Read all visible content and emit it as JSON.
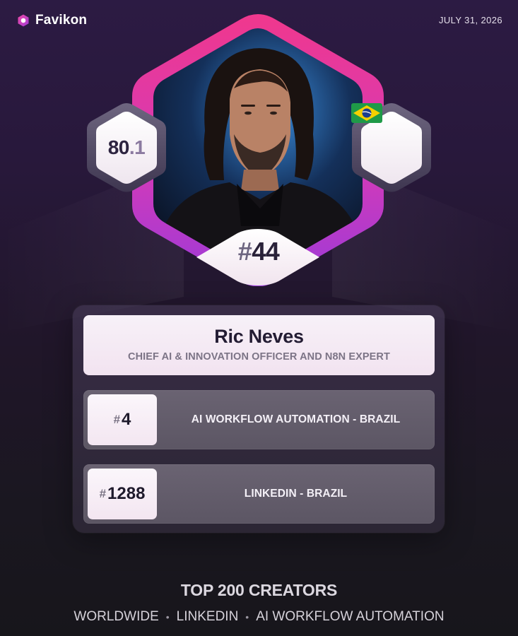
{
  "brand": {
    "name": "Favikon",
    "logo_icon": "favikon-logo-icon"
  },
  "header": {
    "date": "JULY 31, 2026"
  },
  "profile": {
    "photo_alt": "Ric Neves portrait",
    "score_whole": "80",
    "score_fraction": ".1",
    "country_flag": "brazil-flag-icon",
    "overall_rank_hash": "#",
    "overall_rank": "44",
    "name": "Ric Neves",
    "title": "CHIEF AI & INNOVATION OFFICER AND N8N EXPERT"
  },
  "rankings": [
    {
      "hash": "#",
      "rank": "4",
      "label": "AI WORKFLOW AUTOMATION - BRAZIL"
    },
    {
      "hash": "#",
      "rank": "1288",
      "label": "LINKEDIN - BRAZIL"
    }
  ],
  "footer": {
    "title": "TOP 200 CREATORS",
    "tags": [
      "WORLDWIDE",
      "LINKEDIN",
      "AI WORKFLOW AUTOMATION"
    ],
    "separator": "•"
  },
  "colors": {
    "accent_pink": "#e0369b",
    "accent_purple": "#a93cd8",
    "background_top": "#2c1b43",
    "background_bottom": "#17161b"
  }
}
